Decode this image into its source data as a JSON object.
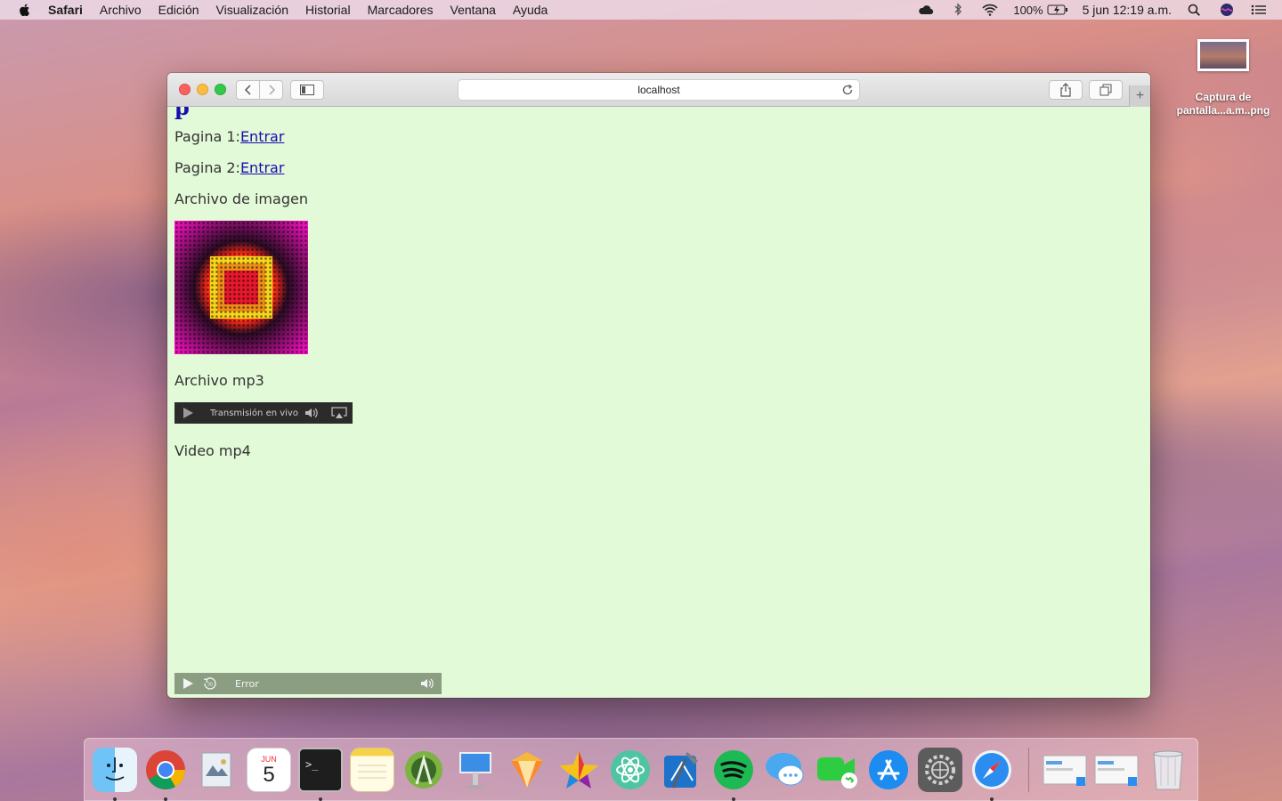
{
  "menubar": {
    "app_name": "Safari",
    "items": [
      "Archivo",
      "Edición",
      "Visualización",
      "Historial",
      "Marcadores",
      "Ventana",
      "Ayuda"
    ],
    "battery": "100%",
    "datetime": "5 jun  12:19 a.m."
  },
  "desktop": {
    "file_label_1": "Captura de",
    "file_label_2": "pantalla...a.m..png"
  },
  "browser": {
    "address": "localhost"
  },
  "page": {
    "cut_heading": "p",
    "line1_label": "Pagina 1:",
    "line1_link": "Entrar",
    "line2_label": "Pagina 2:",
    "line2_link": "Entrar",
    "image_label": "Archivo de imagen",
    "mp3_label": "Archivo mp3",
    "audio_status": "Transmisión en vivo",
    "video_label": "Video mp4",
    "video_status": "Error"
  },
  "dock": {
    "calendar_month": "JUN",
    "calendar_day": "5",
    "apps": [
      "finder",
      "chrome",
      "preview",
      "calendar",
      "terminal",
      "notes",
      "android-studio",
      "keynote",
      "sketch",
      "superstar",
      "atom",
      "xcode",
      "spotify",
      "messages",
      "facetime",
      "app-store",
      "system-preferences",
      "safari"
    ],
    "running": [
      "finder",
      "chrome",
      "terminal",
      "spotify",
      "safari"
    ]
  },
  "colors": {
    "page_bg": "#e3fad8",
    "link": "#1a0dab",
    "audio_bar": "#2b2b2b",
    "video_bar": "#8b9e82"
  }
}
